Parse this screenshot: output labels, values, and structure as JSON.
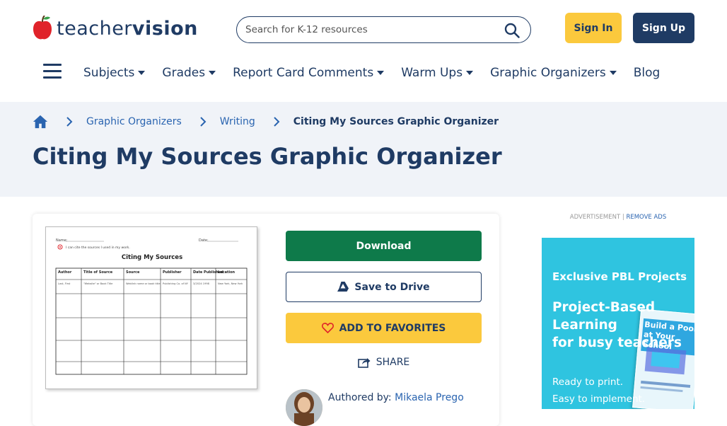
{
  "brand": {
    "logo_light": "teacher",
    "logo_bold": "vision",
    "primary": "#1f3b64",
    "accent": "#fbc93d",
    "green": "#0e7a4a",
    "link": "#2a64b0"
  },
  "search": {
    "placeholder": "Search for K-12 resources"
  },
  "auth": {
    "signin_label": "Sign In",
    "signup_label": "Sign Up"
  },
  "nav": {
    "items": [
      {
        "label": "Subjects",
        "has_dropdown": true
      },
      {
        "label": "Grades",
        "has_dropdown": true
      },
      {
        "label": "Report Card Comments",
        "has_dropdown": true
      },
      {
        "label": "Warm Ups",
        "has_dropdown": true
      },
      {
        "label": "Graphic Organizers",
        "has_dropdown": true
      },
      {
        "label": "Blog",
        "has_dropdown": false
      }
    ]
  },
  "breadcrumb": {
    "items": [
      "Graphic Organizers",
      "Writing"
    ],
    "current": "Citing My Sources Graphic Organizer"
  },
  "page": {
    "title": "Citing My Sources Graphic Organizer"
  },
  "preview": {
    "name_label": "Name:",
    "date_label": "Date:",
    "instruction": "I can cite the sources I used in my work.",
    "heading": "Citing My Sources",
    "columns": [
      "Author",
      "Title of Source",
      "Source",
      "Publisher",
      "Date Published",
      "Location"
    ],
    "example_row": [
      "Last, First",
      "\"Website\" or Book Title",
      "Weblink name or book title",
      "Publishing Co. of NY",
      "3/2024 1998",
      "New York, New York"
    ]
  },
  "actions": {
    "download_label": "Download",
    "drive_label": "Save to Drive",
    "favorites_label": "ADD TO FAVORITES",
    "share_label": "SHARE"
  },
  "author": {
    "prefix": "Authored by:",
    "name": "Mikaela Prego"
  },
  "ad": {
    "label": "ADVERTISEMENT |",
    "remove": "REMOVE ADS",
    "headline": "Exclusive PBL Projects",
    "title_line1": "Project-Based",
    "title_line2": "Learning",
    "title_line3": "for busy teachers",
    "body_line1": "Ready to print.",
    "body_line2": "Easy to implement.",
    "book_title": "Build a Pool at Your School",
    "bg_color": "#2fc4e0"
  }
}
